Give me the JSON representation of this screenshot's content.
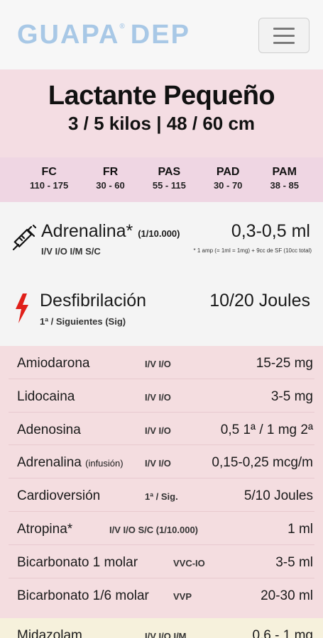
{
  "header": {
    "logo": "GUAPA",
    "logo_reg": "®",
    "logo_suffix": "DEP",
    "menu_icon": "hamburger-icon"
  },
  "title": {
    "main": "Lactante Pequeño",
    "sub": "3 / 5 kilos  | 48 / 60 cm"
  },
  "vitals": [
    {
      "label": "FC",
      "value": "110 - 175"
    },
    {
      "label": "FR",
      "value": "30 - 60"
    },
    {
      "label": "PAS",
      "value": "55 - 115"
    },
    {
      "label": "PAD",
      "value": "30 - 70"
    },
    {
      "label": "PAM",
      "value": "38 - 85"
    }
  ],
  "adrenalina": {
    "icon": "syringe-icon",
    "name": "Adrenalina*",
    "concentration": "(1/10.000)",
    "dose": "0,3-0,5 ml",
    "route": "I/V I/O I/M S/C",
    "note": "* 1 amp (= 1ml = 1mg) + 9cc de SF (10cc total)"
  },
  "desfibrilacion": {
    "icon": "lightning-icon",
    "name": "Desfibrilación",
    "dose": "10/20 Joules",
    "route": "1ª / Siguientes (Sig)"
  },
  "drugs": [
    {
      "name": "Amiodarona",
      "name_small": "",
      "route": "I/V I/O",
      "dose": "15-25 mg"
    },
    {
      "name": "Lidocaina",
      "name_small": "",
      "route": "I/V I/O",
      "dose": "3-5 mg"
    },
    {
      "name": "Adenosina",
      "name_small": "",
      "route": "I/V I/O",
      "dose": "0,5 1ª / 1 mg 2ª"
    },
    {
      "name": "Adrenalina",
      "name_small": "(infusión)",
      "route": "I/V I/O",
      "dose": "0,15-0,25 mcg/m"
    },
    {
      "name": "Cardioversión",
      "name_small": "",
      "route": "1ª / Sig.",
      "dose": "5/10 Joules"
    },
    {
      "name": "Atropina*",
      "name_small": "",
      "route": "I/V I/O S/C  (1/10.000)",
      "dose": "1 ml"
    },
    {
      "name": "Bicarbonato 1 molar",
      "name_small": "",
      "route": "VVC-IO",
      "dose": "3-5 ml"
    },
    {
      "name": "Bicarbonato 1/6 molar",
      "name_small": "",
      "route": "VVP",
      "dose": "20-30 ml"
    }
  ],
  "next": {
    "name": "Midazolam",
    "route": "I/V I/O I/M",
    "dose": "0,6 - 1 mg"
  }
}
